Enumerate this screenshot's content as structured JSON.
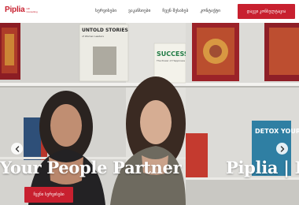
{
  "brand": {
    "logo_text": "Piplia",
    "logo_tagline": "HR Consulting",
    "accent": "#c8202f"
  },
  "nav": {
    "items": [
      "სერვისები",
      "ვაკანსიები",
      "ჩვენ შესახებ",
      "კონტაქტი"
    ]
  },
  "header_cta": {
    "label": "დაგვი კონსულტაცია"
  },
  "hero": {
    "slides": [
      {
        "title": "Your People Partner",
        "button_label": "ჩვენი სერვისები"
      },
      {
        "title": "Piplia | H"
      }
    ],
    "books": [
      {
        "title": "UNTOLD STORIES",
        "subtitle": "of Women Leaders"
      },
      {
        "title": "SUCCESS",
        "subtitle": "The Power of Happiness"
      },
      {
        "title": "DETOX YOUR CULTURE"
      }
    ],
    "prev_icon": "chevron-left-icon",
    "next_icon": "chevron-right-icon"
  }
}
